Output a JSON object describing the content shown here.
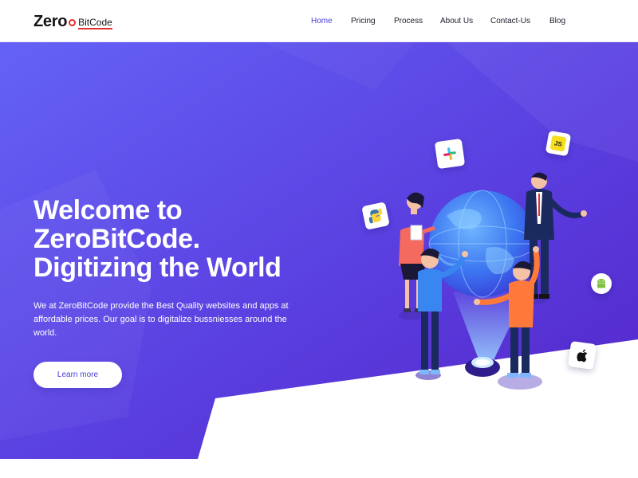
{
  "brand": {
    "zero": "Zero",
    "bitcode": "BitCode"
  },
  "nav": {
    "items": [
      {
        "label": "Home",
        "active": true
      },
      {
        "label": "Pricing",
        "active": false
      },
      {
        "label": "Process",
        "active": false
      },
      {
        "label": "About Us",
        "active": false
      },
      {
        "label": "Contact-Us",
        "active": false
      },
      {
        "label": "Blog",
        "active": false
      }
    ]
  },
  "hero": {
    "title_line1": "Welcome to",
    "title_line2": "ZeroBitCode.",
    "title_line3": "Digitizing the World",
    "description": "We at ZeroBitCode provide the Best Quality websites and apps at affordable prices. Our goal is to digitalize bussniesses around the world.",
    "cta_label": "Learn more"
  },
  "app_icons": [
    "slack-icon",
    "javascript-icon",
    "python-icon",
    "android-icon",
    "apple-icon"
  ],
  "js_badge": "JS",
  "colors": {
    "hero_gradient_start": "#5f60f5",
    "hero_gradient_end": "#5a2bd0",
    "accent": "#4a3fd6",
    "logo_red": "#e03131",
    "nav_text": "#1c1c2b"
  }
}
